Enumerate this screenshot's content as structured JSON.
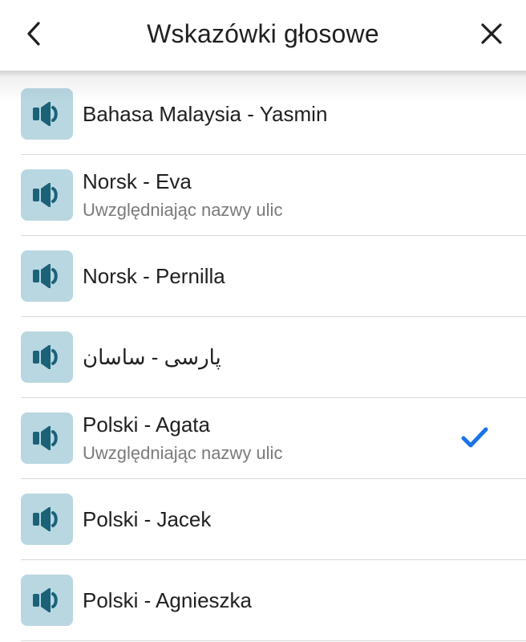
{
  "header": {
    "title": "Wskazówki głosowe",
    "back_icon": "chevron-left-icon",
    "close_icon": "close-icon"
  },
  "colors": {
    "icon_tile": "#b9d7e1",
    "icon_fg": "#1b6178",
    "check": "#1a73e8",
    "title_text": "#1f1f1f",
    "subtitle_text": "#7a7a7a"
  },
  "voices": [
    {
      "title": "Bahasa Malaysia - Yasmin",
      "subtitle": "",
      "selected": false
    },
    {
      "title": "Norsk - Eva",
      "subtitle": "Uwzględniając nazwy ulic",
      "selected": false
    },
    {
      "title": "Norsk - Pernilla",
      "subtitle": "",
      "selected": false
    },
    {
      "title": "پارسی - ساسان",
      "subtitle": "",
      "selected": false
    },
    {
      "title": "Polski - Agata",
      "subtitle": "Uwzględniając nazwy ulic",
      "selected": true
    },
    {
      "title": "Polski - Jacek",
      "subtitle": "",
      "selected": false
    },
    {
      "title": "Polski - Agnieszka",
      "subtitle": "",
      "selected": false
    }
  ]
}
